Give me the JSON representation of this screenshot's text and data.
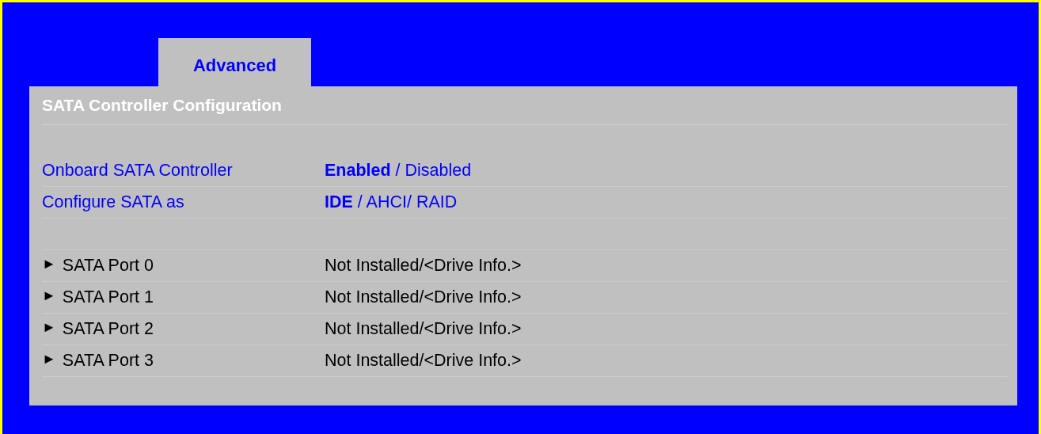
{
  "tabs": [
    {
      "label": "Advanced",
      "selected": true
    }
  ],
  "panel": {
    "title": "SATA Controller Configuration",
    "rows": [
      {
        "kind": "setting",
        "label": "Onboard SATA Controller",
        "value": "**Enabled** / Disabled"
      },
      {
        "kind": "setting",
        "label": "Configure SATA as",
        "value": "**IDE** / AHCI/ RAID"
      },
      {
        "kind": "spacer"
      },
      {
        "kind": "submenu",
        "arrow": "►",
        "label": "SATA Port 0",
        "value": "Not Installed/<Drive Info.>"
      },
      {
        "kind": "submenu",
        "arrow": "►",
        "label": "SATA Port 1",
        "value": "Not Installed/<Drive Info.>"
      },
      {
        "kind": "submenu",
        "arrow": "►",
        "label": "SATA Port 2",
        "value": "Not Installed/<Drive Info.>"
      },
      {
        "kind": "submenu",
        "arrow": "►",
        "label": "SATA Port 3",
        "value": "Not Installed/<Drive Info.>"
      }
    ]
  }
}
